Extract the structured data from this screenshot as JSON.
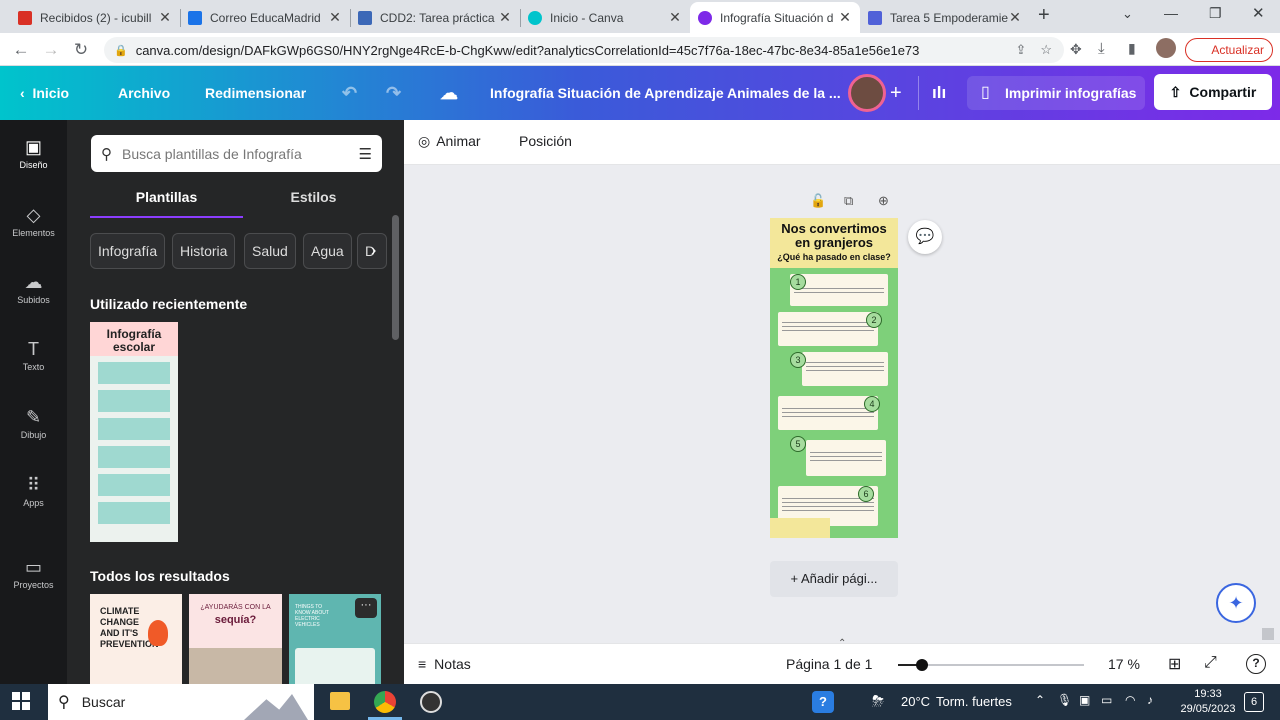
{
  "browser": {
    "tabs": [
      {
        "title": "Recibidos (2) - icubill",
        "favicon_color": "#d93025"
      },
      {
        "title": "Correo EducaMadrid",
        "favicon_color": "#1a73e8"
      },
      {
        "title": "CDD2: Tarea práctica",
        "favicon_color": "#3c68b7"
      },
      {
        "title": "Inicio - Canva",
        "favicon_color": "#00c4cc"
      },
      {
        "title": "Infografía Situación d",
        "favicon_color": "#7d2ae8"
      },
      {
        "title": "Tarea 5 Empoderamie",
        "favicon_color": "#5061d8"
      }
    ],
    "url": "canva.com/design/DAFkGWp6GS0/HNY2rgNge4RcE-b-ChgKww/edit?analyticsCorrelationId=45c7f76a-18ec-47bc-8e34-85a1e56e1e73",
    "update_label": "Actualizar"
  },
  "header": {
    "home": "Inicio",
    "file": "Archivo",
    "resize": "Redimensionar",
    "title": "Infografía Situación de Aprendizaje Animales de la ...",
    "print": "Imprimir infografías",
    "share": "Compartir"
  },
  "rail": [
    {
      "label": "Diseño",
      "icon": "layout-icon"
    },
    {
      "label": "Elementos",
      "icon": "shapes-icon"
    },
    {
      "label": "Subidos",
      "icon": "cloud-upload-icon"
    },
    {
      "label": "Texto",
      "icon": "text-icon"
    },
    {
      "label": "Dibujo",
      "icon": "pen-icon"
    },
    {
      "label": "Apps",
      "icon": "grid-icon"
    },
    {
      "label": "Proyectos",
      "icon": "folder-icon"
    }
  ],
  "panel": {
    "search_placeholder": "Busca plantillas de Infografía",
    "tab_templates": "Plantillas",
    "tab_styles": "Estilos",
    "chips": [
      "Infografía",
      "Historia",
      "Salud",
      "Agua",
      "D"
    ],
    "recent_heading": "Utilizado recientemente",
    "recent_title": "Infografía escolar",
    "all_results": "Todos los resultados",
    "results": [
      {
        "line1": "CLIMATE",
        "line2": "CHANGE",
        "line3": "AND IT'S",
        "line4": "PREVENTION"
      },
      {
        "line1": "¿AYUDARÁS CON LA",
        "line2": "sequía?"
      },
      {
        "line1": "THINGS TO KNOW ABOUT ELECTRIC VEHICLES"
      }
    ]
  },
  "editor": {
    "animate": "Animar",
    "position": "Posición",
    "add_page": "+ Añadir pági...",
    "design_title_1": "Nos convertimos",
    "design_title_2": "en granjeros",
    "design_subtitle": "¿Qué ha pasado en clase?",
    "steps": [
      "1",
      "2",
      "3",
      "4",
      "5",
      "6"
    ]
  },
  "bottom": {
    "notes": "Notas",
    "page_indicator": "Página 1 de 1",
    "zoom": "17 %"
  },
  "taskbar": {
    "search": "Buscar",
    "weather_temp": "20°C",
    "weather_text": "Torm. fuertes",
    "time": "19:33",
    "date": "29/05/2023",
    "notif_count": "6"
  }
}
